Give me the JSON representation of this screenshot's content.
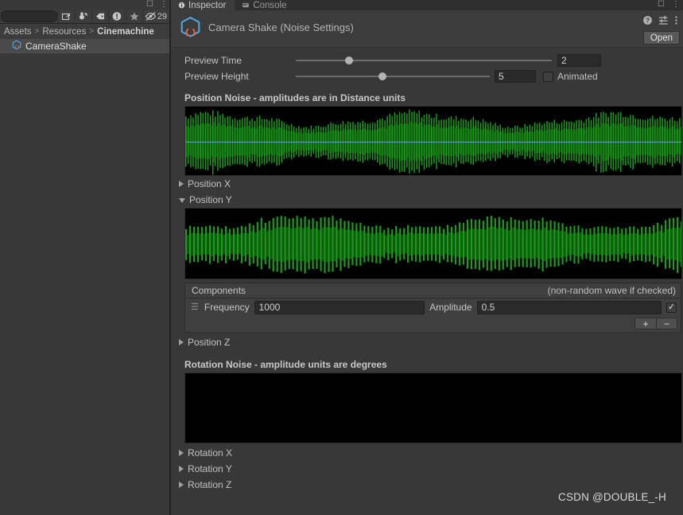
{
  "project_panel": {
    "toolbar": {
      "search_placeholder": "",
      "search_value": "",
      "icons": [
        "popup-window-icon",
        "object-filter-icon",
        "label-filter-icon",
        "warning-filter-icon",
        "favorite-star-icon"
      ],
      "hidden_count": "29"
    },
    "breadcrumb": {
      "items": [
        "Assets",
        "Resources",
        "Cinemachine"
      ],
      "separator": ">"
    },
    "assets": [
      {
        "name": "CameraShake",
        "icon": "noise-settings-asset-icon",
        "selected": true
      }
    ]
  },
  "inspector": {
    "tabs": [
      {
        "label": "Inspector",
        "icon": "info-icon",
        "active": true
      },
      {
        "label": "Console",
        "icon": "console-icon",
        "active": false
      }
    ],
    "window_controls": [
      "maximize-icon",
      "more-options-icon"
    ],
    "header": {
      "title": "Camera Shake (Noise Settings)",
      "icon": "noise-settings-asset-icon",
      "actions": [
        "help-icon",
        "preset-icon",
        "more-menu-icon"
      ],
      "open_label": "Open"
    },
    "preview": {
      "time": {
        "label": "Preview Time",
        "value": "2",
        "slider_pct": 21
      },
      "height": {
        "label": "Preview Height",
        "value": "5",
        "slider_pct": 35
      },
      "animated": {
        "label": "Animated",
        "checked": false
      }
    },
    "position_noise": {
      "title": "Position Noise - amplitudes are in Distance units",
      "axes": [
        {
          "label": "Position X",
          "expanded": false
        },
        {
          "label": "Position Y",
          "expanded": true
        },
        {
          "label": "Position Z",
          "expanded": false
        }
      ],
      "components_panel": {
        "title": "Components",
        "hint": "(non-random wave if checked)",
        "rows": [
          {
            "frequency_label": "Frequency",
            "frequency_value": "1000",
            "amplitude_label": "Amplitude",
            "amplitude_value": "0.5",
            "constant_checked": true
          }
        ],
        "add_label": "+",
        "remove_label": "−"
      }
    },
    "rotation_noise": {
      "title": "Rotation Noise - amplitude units are degrees",
      "axes": [
        {
          "label": "Rotation X",
          "expanded": false
        },
        {
          "label": "Rotation Y",
          "expanded": false
        },
        {
          "label": "Rotation Z",
          "expanded": false
        }
      ]
    }
  },
  "watermark": "CSDN @DOUBLE_-H",
  "colors": {
    "background": "#383838",
    "panel": "#3c3c3c",
    "wave_green": "#1d9b1d",
    "wave_midline": "#7fa8c9",
    "graph_bg": "#000000",
    "text": "#c2c2c2",
    "accent_orange": "#e8603c",
    "accent_blue": "#4ea8de"
  }
}
